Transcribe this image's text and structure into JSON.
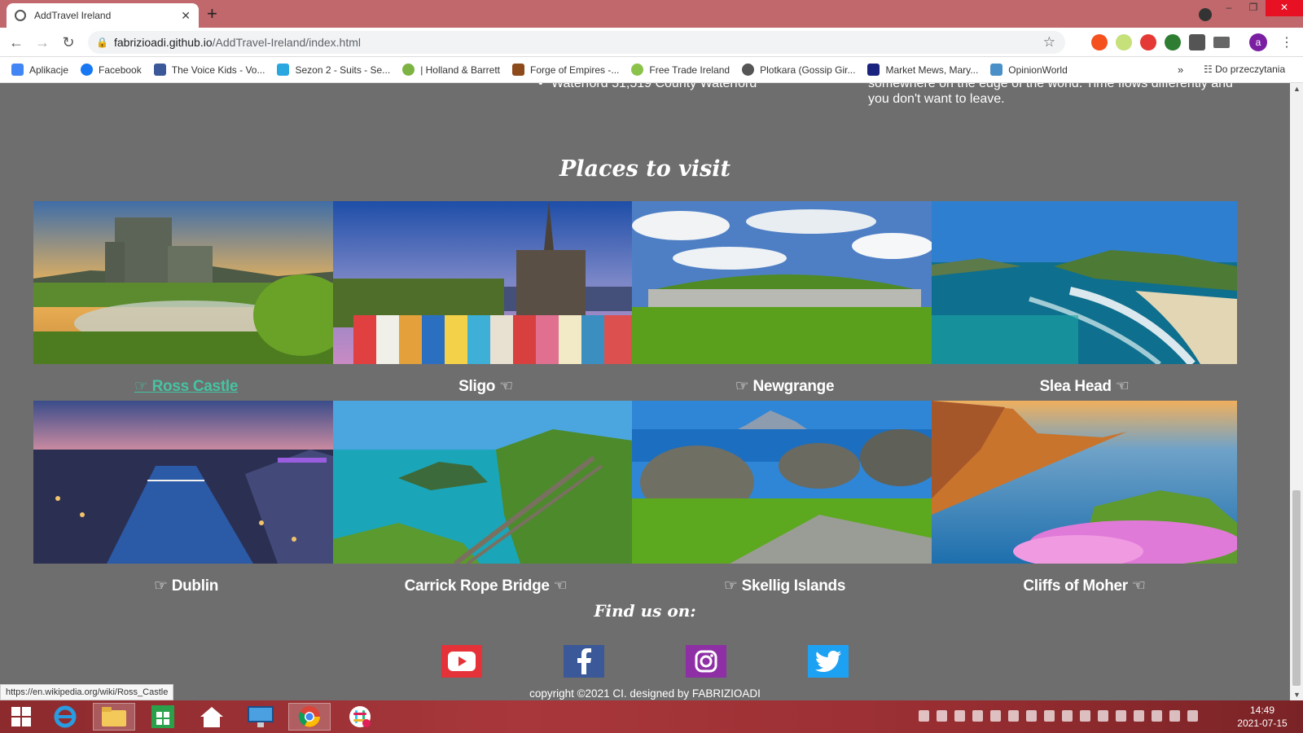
{
  "browser": {
    "tab_title": "AddTravel Ireland",
    "url_host": "fabrizioadi.github.io",
    "url_path": "/AddTravel-Ireland/index.html",
    "bookmarks": [
      {
        "label": "Aplikacje",
        "color": "#4285f4"
      },
      {
        "label": "Facebook",
        "color": "#1877f2"
      },
      {
        "label": "The Voice Kids - Vo...",
        "color": "#3b5998"
      },
      {
        "label": "Sezon 2 - Suits - Se...",
        "color": "#29a8e0"
      },
      {
        "label": "| Holland & Barrett",
        "color": "#7cb342"
      },
      {
        "label": "Forge of Empires -...",
        "color": "#8d4a1a"
      },
      {
        "label": "Free Trade Ireland",
        "color": "#8bc34a"
      },
      {
        "label": "Plotkara (Gossip Gir...",
        "color": "#555555"
      },
      {
        "label": "Market Mews, Mary...",
        "color": "#1a237e"
      },
      {
        "label": "OpinionWorld",
        "color": "#4a90c8"
      }
    ],
    "reading_list": "Do przeczytania",
    "avatar_letter": "a",
    "status_url": "https://en.wikipedia.org/wiki/Ross_Castle"
  },
  "page": {
    "population_cut": "Waterford 51,519 County Waterford",
    "description_cut": "somewhere on the edge of the world. Time flows differently and you don't want to leave.",
    "places_title": "Places to visit",
    "places": [
      {
        "name": "Ross Castle",
        "hand": "left"
      },
      {
        "name": "Sligo",
        "hand": "right"
      },
      {
        "name": "Newgrange",
        "hand": "left"
      },
      {
        "name": "Slea Head",
        "hand": "right"
      },
      {
        "name": "Dublin",
        "hand": "left"
      },
      {
        "name": "Carrick Rope Bridge",
        "hand": "right"
      },
      {
        "name": "Skellig Islands",
        "hand": "left"
      },
      {
        "name": "Cliffs of Moher",
        "hand": "right"
      }
    ],
    "find_us": "Find us on:",
    "social": [
      {
        "name": "youtube-icon",
        "color": "#e53238"
      },
      {
        "name": "facebook-icon",
        "color": "#3b5998"
      },
      {
        "name": "instagram-icon",
        "color": "#8e2fa5"
      },
      {
        "name": "twitter-icon",
        "color": "#1da1f2"
      }
    ],
    "copyright": "copyright ©2021 CI. designed by FABRIZIOADI",
    "accent": "#46c3a2"
  },
  "taskbar": {
    "time": "14:49",
    "date": "2021-07-15"
  }
}
